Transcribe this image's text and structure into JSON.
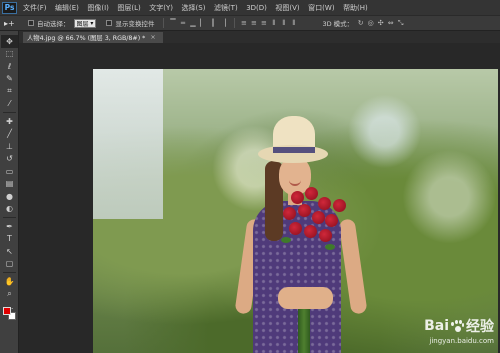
{
  "app": {
    "logo": "Ps"
  },
  "menu": [
    "文件(F)",
    "编辑(E)",
    "图像(I)",
    "图层(L)",
    "文字(Y)",
    "选择(S)",
    "滤镜(T)",
    "3D(D)",
    "视图(V)",
    "窗口(W)",
    "帮助(H)"
  ],
  "options": {
    "tool_glyph": "▸+",
    "auto_select_label": "自动选择：",
    "auto_select_value": "图层",
    "show_transform_label": "显示变换控件",
    "mode_3d_label": "3D 模式："
  },
  "document_tab": {
    "title": "人物4.jpg @ 66.7% (图层 3, RGB/8#) *",
    "close": "×"
  },
  "colors": {
    "foreground": "#e10000",
    "background": "#ffffff"
  },
  "toolbar": [
    {
      "icon": "move-icon",
      "glyph": "✥"
    },
    {
      "icon": "marquee-icon",
      "glyph": "⬚"
    },
    {
      "icon": "lasso-icon",
      "glyph": "ℓ"
    },
    {
      "icon": "quick-select-icon",
      "glyph": "✎"
    },
    {
      "icon": "crop-icon",
      "glyph": "⌗"
    },
    {
      "icon": "eyedropper-icon",
      "glyph": "⁄"
    },
    {
      "icon": "healing-icon",
      "glyph": "✚"
    },
    {
      "icon": "brush-icon",
      "glyph": "╱"
    },
    {
      "icon": "clone-stamp-icon",
      "glyph": "⊥"
    },
    {
      "icon": "history-brush-icon",
      "glyph": "↺"
    },
    {
      "icon": "eraser-icon",
      "glyph": "▭"
    },
    {
      "icon": "gradient-icon",
      "glyph": "▤"
    },
    {
      "icon": "blur-icon",
      "glyph": "●"
    },
    {
      "icon": "dodge-icon",
      "glyph": "◐"
    },
    {
      "icon": "pen-icon",
      "glyph": "✒"
    },
    {
      "icon": "type-icon",
      "glyph": "T"
    },
    {
      "icon": "path-select-icon",
      "glyph": "↖"
    },
    {
      "icon": "shape-icon",
      "glyph": "▢"
    },
    {
      "icon": "hand-icon",
      "glyph": "✋"
    },
    {
      "icon": "zoom-icon",
      "glyph": "⌕"
    },
    {
      "icon": "more-icon",
      "glyph": "…"
    }
  ],
  "watermark": {
    "brand_left": "Bai",
    "brand_right": "经验",
    "url": "jingyan.baidu.com"
  }
}
